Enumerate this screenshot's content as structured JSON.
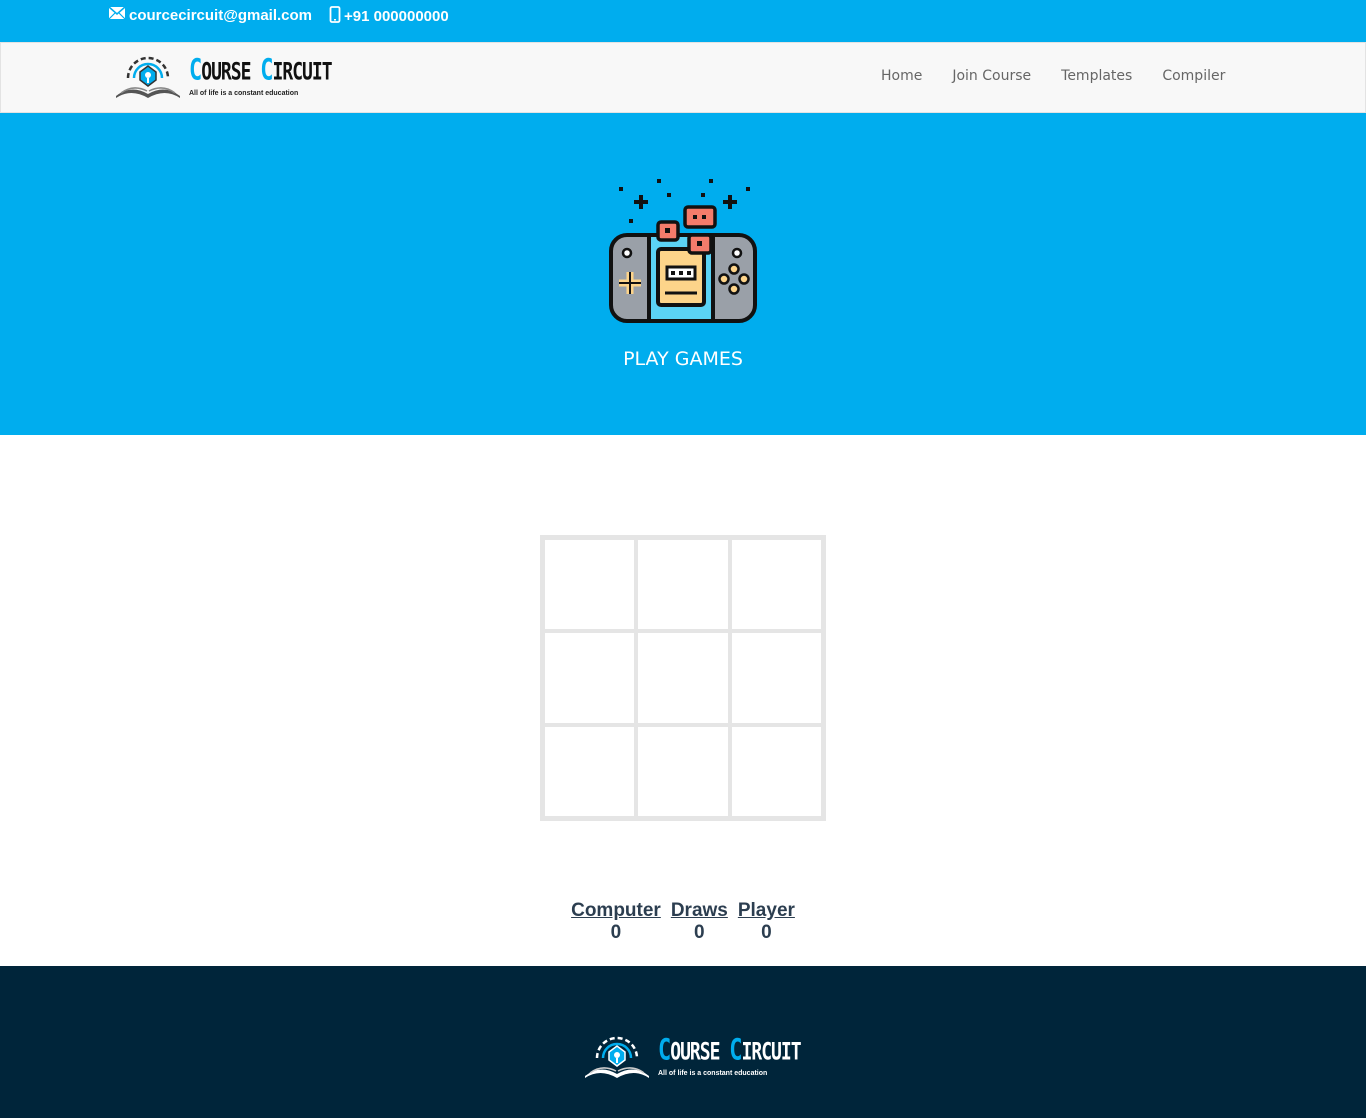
{
  "topbar": {
    "email": "courcecircuit@gmail.com",
    "phone": "+91 000000000",
    "email_icon": "envelope-icon",
    "phone_icon": "mobile-phone-icon"
  },
  "brand": {
    "name_first_cap": "C",
    "name_first_rest": "OURSE ",
    "name_second_cap": "C",
    "name_second_rest": "IRCUIT",
    "tagline": "All of life is a constant education",
    "accent_color": "#00adee"
  },
  "nav": {
    "items": [
      {
        "label": "Home"
      },
      {
        "label": "Join Course"
      },
      {
        "label": "Templates"
      },
      {
        "label": "Compiler"
      }
    ]
  },
  "hero": {
    "icon": "game-console-icon",
    "title": "PLAY GAMES",
    "background": "#00adee"
  },
  "board": {
    "cells": [
      "",
      "",
      "",
      "",
      "",
      "",
      "",
      "",
      ""
    ]
  },
  "scores": [
    {
      "label": "Computer",
      "value": "0"
    },
    {
      "label": "Draws",
      "value": "0"
    },
    {
      "label": "Player",
      "value": "0"
    }
  ],
  "footer": {
    "background": "#00253a"
  }
}
